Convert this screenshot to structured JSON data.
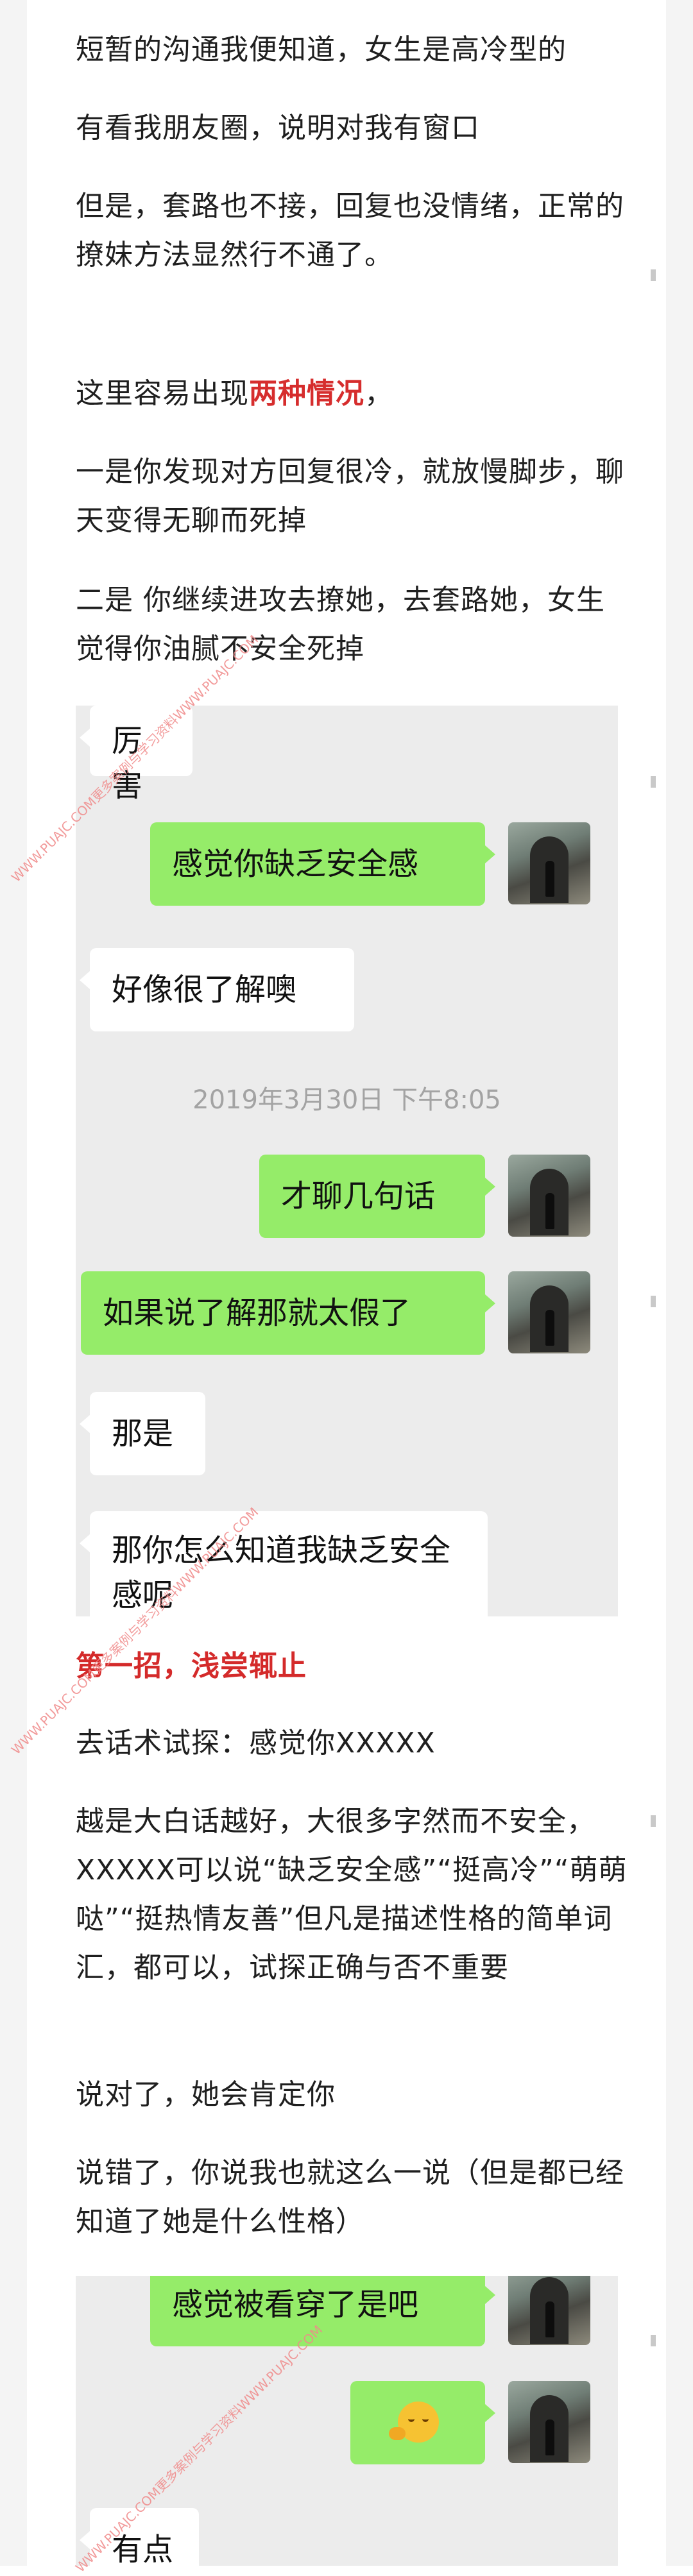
{
  "article": {
    "p1": "短暂的沟通我便知道，女生是高冷型的",
    "p2": "有看我朋友圈，说明对我有窗口",
    "p3": "但是，套路也不接，回复也没情绪，正常的撩妹方法显然行不通了。",
    "p4_prefix": "这里容易出现",
    "p4_highlight": "两种情况",
    "p4_suffix": "，",
    "p5": "一是你发现对方回复很冷，就放慢脚步，聊天变得无聊而死掉",
    "p6": "二是 你继续进攻去撩她，去套路她，女生觉得你油腻不安全死掉",
    "heading": "第一招，浅尝辄止",
    "p7": "去话术试探：感觉你XXXXX",
    "p8": "越是大白话越好，大很多字然而不安全，XXXXX可以说“缺乏安全感”“挺高冷”“萌萌哒”“挺热情友善”但凡是描述性格的简单词汇，都可以，试探正确与否不重要",
    "p9": "说对了，她会肯定你",
    "p10": "说错了，你说我也就这么一说（但是都已经知道了她是什么性格）"
  },
  "chat1": {
    "messages": [
      {
        "side": "left",
        "text": "厉害"
      },
      {
        "side": "right",
        "text": "感觉你缺乏安全感"
      },
      {
        "side": "left",
        "text": "好像很了解噢"
      },
      {
        "side": "right",
        "text": "才聊几句话"
      },
      {
        "side": "right",
        "text": "如果说了解那就太假了"
      },
      {
        "side": "left",
        "text": "那是"
      },
      {
        "side": "left",
        "text": "那你怎么知道我缺乏安全感呢"
      }
    ],
    "timestamp": "2019年3月30日 下午8:05"
  },
  "chat2": {
    "messages": [
      {
        "side": "right",
        "text": "感觉被看穿了是吧"
      },
      {
        "side": "right",
        "text": "[emoji]"
      },
      {
        "side": "left",
        "text": "有点"
      }
    ]
  },
  "watermark": {
    "text": "WWW.PUAJC.COM更多案例与学习资料WWW.PUAJC.COM"
  },
  "colors": {
    "highlight_red": "#d62d2d",
    "bubble_green": "#95ec69",
    "chat_background": "#ececec"
  }
}
